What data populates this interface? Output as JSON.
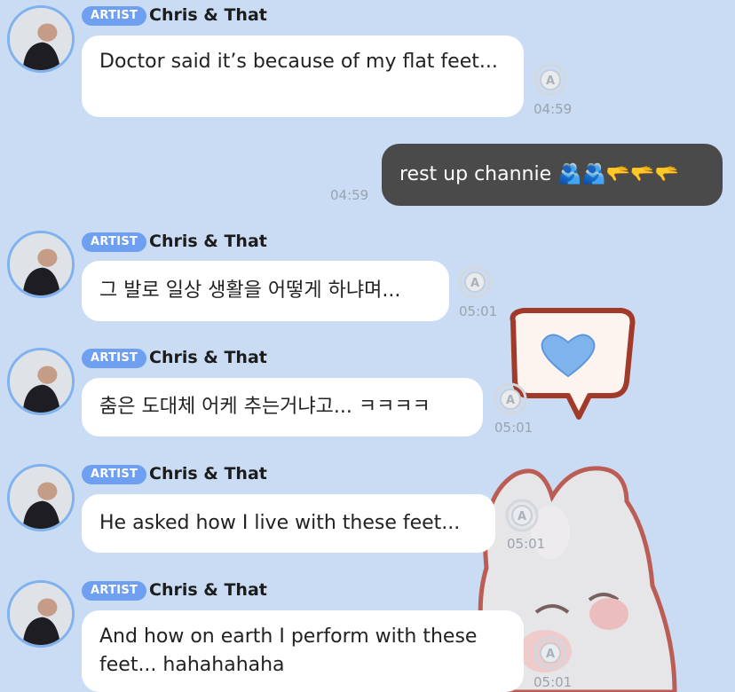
{
  "badge_label": "ARTIST",
  "sender_name": "Chris & That",
  "messages": [
    {
      "text": "Doctor said it’s because of my flat feet...",
      "time": "04:59"
    },
    {
      "text": "rest up channie 🫂🫂🫳🫳🫳",
      "time": "04:59"
    },
    {
      "text": "그 발로 일상 생활을 어떻게 하냐며...",
      "time": "05:01"
    },
    {
      "text": "춤은 도대체 어케 추는거냐고... ㅋㅋㅋㅋ",
      "time": "05:01"
    },
    {
      "text": "He asked how I live with these feet...",
      "time": "05:01"
    },
    {
      "text": "And how on earth I perform with these feet... hahahahaha",
      "time": "05:01"
    }
  ],
  "colors": {
    "background": "#c9dcf4",
    "badge": "#6f9ff0",
    "bubble": "#ffffff",
    "own_bubble": "#4a4a4a"
  }
}
